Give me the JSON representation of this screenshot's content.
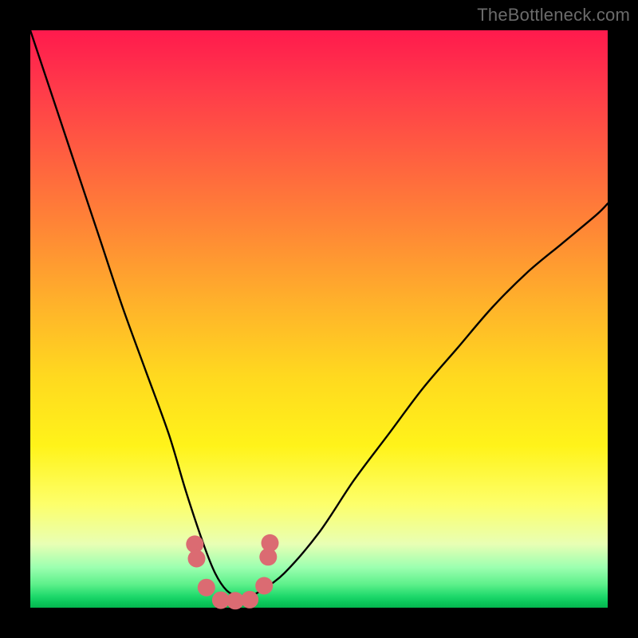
{
  "watermark": "TheBottleneck.com",
  "chart_data": {
    "type": "line",
    "title": "",
    "xlabel": "",
    "ylabel": "",
    "xlim": [
      0,
      100
    ],
    "ylim": [
      0,
      100
    ],
    "series": [
      {
        "name": "bottleneck-curve",
        "x": [
          0,
          4,
          8,
          12,
          16,
          20,
          24,
          27,
          30,
          32,
          34,
          36,
          38,
          40,
          44,
          50,
          56,
          62,
          68,
          74,
          80,
          86,
          92,
          98,
          100
        ],
        "values": [
          100,
          88,
          76,
          64,
          52,
          41,
          30,
          20,
          11,
          6,
          3,
          2,
          2,
          3,
          6,
          13,
          22,
          30,
          38,
          45,
          52,
          58,
          63,
          68,
          70
        ]
      }
    ],
    "markers": {
      "name": "highlight-dots",
      "color": "#db6b72",
      "points": [
        {
          "x": 28.5,
          "y": 11
        },
        {
          "x": 28.8,
          "y": 8.5
        },
        {
          "x": 30.5,
          "y": 3.5
        },
        {
          "x": 33.0,
          "y": 1.3
        },
        {
          "x": 35.5,
          "y": 1.2
        },
        {
          "x": 38.0,
          "y": 1.4
        },
        {
          "x": 40.5,
          "y": 3.8
        },
        {
          "x": 41.2,
          "y": 8.8
        },
        {
          "x": 41.5,
          "y": 11.2
        }
      ]
    }
  }
}
